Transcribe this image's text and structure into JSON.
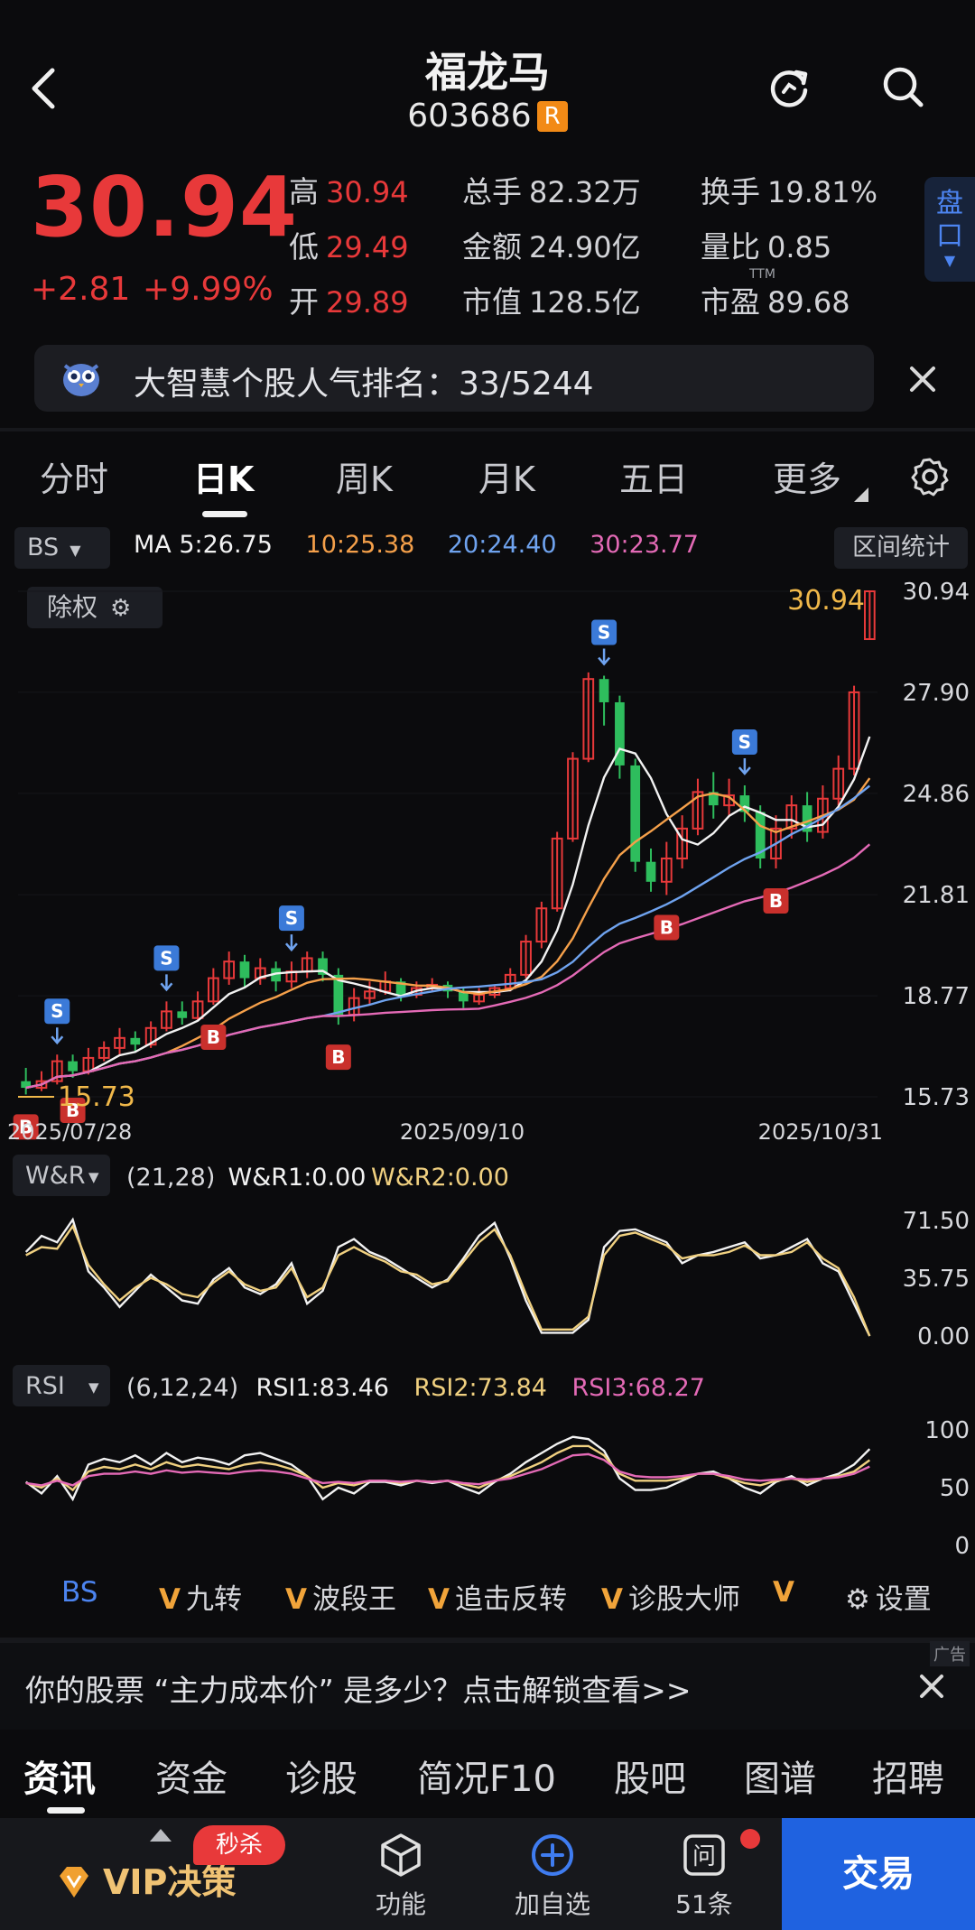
{
  "header": {
    "stock_name": "福龙马",
    "stock_code": "603686",
    "code_badge": "R",
    "back_icon": "chevron-left-icon",
    "refresh_icon": "refresh-icon",
    "search_icon": "search-icon"
  },
  "quote": {
    "price": "30.94",
    "change": "+2.81",
    "change_pct": "+9.99%",
    "fields": [
      {
        "label": "高",
        "value": "30.94",
        "color": "#e8393a"
      },
      {
        "label": "低",
        "value": "29.49",
        "color": "#e8393a"
      },
      {
        "label": "开",
        "value": "29.89",
        "color": "#e8393a"
      },
      {
        "label": "总手",
        "value": "82.32万",
        "color": "#ececec"
      },
      {
        "label": "金额",
        "value": "24.90亿",
        "color": "#ececec"
      },
      {
        "label": "市值",
        "value": "128.5亿",
        "color": "#ececec"
      },
      {
        "label": "换手",
        "value": "19.81%",
        "color": "#ececec"
      },
      {
        "label": "量比",
        "value": "0.85",
        "color": "#ececec"
      },
      {
        "label": "市盈",
        "value": "89.68",
        "color": "#ececec"
      }
    ],
    "pe_tag": "TTM",
    "pankou_label": "盘口"
  },
  "banner": {
    "text": "大智慧个股人气排名：33/5244",
    "icon": "owl-icon"
  },
  "period_tabs": [
    "分时",
    "日K",
    "周K",
    "月K",
    "五日",
    "更多"
  ],
  "active_period": "日K",
  "chart_toolbar": {
    "bs_select": "BS",
    "ma_items": [
      {
        "text": "MA 5:26.75",
        "color": "#f2f2f2"
      },
      {
        "text": "10:25.38",
        "color": "#f5a04a"
      },
      {
        "text": "20:24.40",
        "color": "#6fa3ef"
      },
      {
        "text": "30:23.77",
        "color": "#e46ab6"
      }
    ],
    "interval_stats": "区间统计",
    "ex_rights": "除权"
  },
  "chart_data": [
    {
      "type": "candlestick",
      "title": "",
      "price_axis_labels": [
        "30.94",
        "27.90",
        "24.86",
        "21.81",
        "18.77",
        "15.73"
      ],
      "date_labels": [
        "2025/07/28",
        "2025/09/10",
        "2025/10/31"
      ],
      "last_price_label": "30.94",
      "low_price_label": "15.73",
      "ylim": [
        15.73,
        30.94
      ],
      "candles": [
        [
          16.2,
          16.0,
          16.6,
          15.8
        ],
        [
          16.0,
          16.2,
          16.5,
          15.9
        ],
        [
          16.2,
          16.8,
          17.0,
          16.1
        ],
        [
          16.8,
          16.5,
          17.0,
          16.3
        ],
        [
          16.5,
          16.9,
          17.2,
          16.4
        ],
        [
          16.9,
          17.2,
          17.4,
          16.8
        ],
        [
          17.2,
          17.5,
          17.8,
          17.0
        ],
        [
          17.5,
          17.3,
          17.7,
          17.1
        ],
        [
          17.3,
          17.8,
          18.0,
          17.2
        ],
        [
          17.8,
          18.3,
          18.6,
          17.7
        ],
        [
          18.3,
          18.1,
          18.6,
          17.9
        ],
        [
          18.1,
          18.6,
          18.9,
          18.0
        ],
        [
          18.6,
          19.3,
          19.6,
          18.5
        ],
        [
          19.3,
          19.8,
          20.1,
          19.1
        ],
        [
          19.8,
          19.3,
          20.0,
          19.0
        ],
        [
          19.3,
          19.6,
          19.9,
          19.1
        ],
        [
          19.6,
          19.2,
          19.8,
          18.9
        ],
        [
          19.2,
          19.5,
          19.8,
          19.0
        ],
        [
          19.5,
          19.9,
          20.1,
          19.3
        ],
        [
          19.9,
          19.4,
          20.1,
          19.2
        ],
        [
          19.4,
          18.2,
          19.6,
          17.9
        ],
        [
          18.2,
          18.7,
          19.0,
          18.0
        ],
        [
          18.7,
          18.9,
          19.2,
          18.5
        ],
        [
          18.9,
          19.2,
          19.5,
          18.8
        ],
        [
          19.2,
          18.8,
          19.3,
          18.6
        ],
        [
          18.8,
          19.0,
          19.2,
          18.7
        ],
        [
          19.0,
          19.1,
          19.3,
          18.9
        ],
        [
          19.1,
          18.9,
          19.2,
          18.7
        ],
        [
          18.9,
          18.6,
          19.0,
          18.4
        ],
        [
          18.6,
          18.8,
          19.0,
          18.5
        ],
        [
          18.8,
          19.0,
          19.1,
          18.7
        ],
        [
          19.0,
          19.4,
          19.6,
          18.9
        ],
        [
          19.4,
          20.4,
          20.6,
          19.3
        ],
        [
          20.4,
          21.4,
          21.6,
          20.2
        ],
        [
          21.4,
          23.5,
          23.7,
          21.3
        ],
        [
          23.5,
          25.9,
          26.1,
          23.4
        ],
        [
          25.9,
          28.3,
          28.5,
          25.8
        ],
        [
          28.3,
          27.6,
          28.4,
          26.9
        ],
        [
          27.6,
          25.7,
          27.8,
          25.3
        ],
        [
          25.7,
          22.8,
          25.9,
          22.5
        ],
        [
          22.8,
          22.2,
          23.2,
          21.9
        ],
        [
          22.2,
          22.9,
          23.4,
          21.8
        ],
        [
          22.9,
          23.8,
          24.2,
          22.6
        ],
        [
          23.8,
          24.9,
          25.3,
          23.6
        ],
        [
          24.9,
          24.5,
          25.5,
          24.1
        ],
        [
          24.5,
          24.8,
          25.3,
          24.2
        ],
        [
          24.8,
          24.3,
          25.1,
          24.0
        ],
        [
          24.3,
          22.9,
          24.5,
          22.6
        ],
        [
          22.9,
          23.8,
          24.2,
          22.6
        ],
        [
          23.8,
          24.5,
          24.8,
          23.5
        ],
        [
          24.5,
          23.7,
          24.9,
          23.4
        ],
        [
          23.7,
          24.7,
          25.1,
          23.5
        ],
        [
          24.7,
          25.6,
          26.0,
          24.5
        ],
        [
          25.6,
          27.9,
          28.1,
          25.4
        ],
        [
          29.5,
          30.94,
          30.94,
          29.49
        ]
      ],
      "ma_series": [
        {
          "name": "MA5",
          "color": "#f2f2f2"
        },
        {
          "name": "MA10",
          "color": "#f5a04a"
        },
        {
          "name": "MA20",
          "color": "#6fa3ef"
        },
        {
          "name": "MA30",
          "color": "#e46ab6"
        }
      ],
      "signals": [
        {
          "type": "B",
          "index": 0
        },
        {
          "type": "S",
          "index": 2
        },
        {
          "type": "B",
          "index": 3
        },
        {
          "type": "S",
          "index": 9
        },
        {
          "type": "B",
          "index": 12
        },
        {
          "type": "S",
          "index": 17
        },
        {
          "type": "B",
          "index": 20
        },
        {
          "type": "S",
          "index": 37
        },
        {
          "type": "B",
          "index": 41
        },
        {
          "type": "S",
          "index": 46
        },
        {
          "type": "B",
          "index": 48
        }
      ]
    },
    {
      "type": "line",
      "title": "W&R",
      "params": "(21,28)",
      "legend": [
        {
          "name": "W&R1:0.00",
          "color": "#f2f2f2"
        },
        {
          "name": "W&R2:0.00",
          "color": "#f0d080"
        }
      ],
      "axis_labels": [
        "71.50",
        "35.75",
        "0.00"
      ],
      "ylim": [
        0,
        71.5
      ],
      "series": [
        {
          "name": "W&R1",
          "color": "#f2f2f2",
          "values": [
            52,
            62,
            58,
            72,
            40,
            30,
            18,
            28,
            38,
            30,
            22,
            20,
            35,
            42,
            30,
            26,
            32,
            45,
            20,
            28,
            55,
            60,
            52,
            48,
            42,
            36,
            30,
            35,
            48,
            62,
            70,
            48,
            22,
            2,
            2,
            2,
            10,
            55,
            65,
            66,
            62,
            58,
            45,
            50,
            52,
            55,
            58,
            48,
            50,
            55,
            60,
            45,
            40,
            20,
            0
          ]
        },
        {
          "name": "W&R2",
          "color": "#f0d080",
          "values": [
            50,
            55,
            54,
            68,
            44,
            32,
            22,
            30,
            36,
            32,
            26,
            24,
            33,
            40,
            32,
            28,
            30,
            42,
            24,
            30,
            50,
            55,
            50,
            46,
            40,
            38,
            32,
            34,
            46,
            58,
            66,
            50,
            26,
            4,
            4,
            4,
            12,
            50,
            62,
            64,
            60,
            56,
            48,
            50,
            50,
            52,
            56,
            50,
            50,
            52,
            58,
            48,
            42,
            24,
            0
          ]
        }
      ]
    },
    {
      "type": "line",
      "title": "RSI",
      "params": "(6,12,24)",
      "legend": [
        {
          "name": "RSI1:83.46",
          "color": "#f2f2f2"
        },
        {
          "name": "RSI2:73.84",
          "color": "#f0d080"
        },
        {
          "name": "RSI3:68.27",
          "color": "#e46ab6"
        }
      ],
      "axis_labels": [
        "100",
        "50",
        "0"
      ],
      "ylim": [
        0,
        100
      ],
      "series": [
        {
          "name": "RSI1",
          "color": "#f2f2f2",
          "values": [
            55,
            45,
            60,
            40,
            70,
            75,
            72,
            78,
            70,
            80,
            72,
            76,
            74,
            70,
            78,
            80,
            75,
            70,
            60,
            40,
            50,
            45,
            55,
            55,
            52,
            56,
            54,
            56,
            50,
            45,
            55,
            62,
            72,
            80,
            88,
            94,
            92,
            82,
            58,
            48,
            48,
            50,
            56,
            62,
            64,
            58,
            50,
            45,
            55,
            60,
            52,
            58,
            62,
            70,
            83.46
          ]
        },
        {
          "name": "RSI2",
          "color": "#f0d080",
          "values": [
            54,
            50,
            58,
            48,
            64,
            68,
            66,
            70,
            66,
            72,
            68,
            70,
            68,
            66,
            70,
            72,
            70,
            66,
            60,
            50,
            54,
            52,
            56,
            56,
            54,
            56,
            55,
            56,
            53,
            50,
            56,
            60,
            66,
            72,
            80,
            86,
            86,
            78,
            62,
            56,
            56,
            56,
            58,
            62,
            62,
            58,
            54,
            52,
            56,
            58,
            55,
            58,
            60,
            64,
            73.84
          ]
        },
        {
          "name": "RSI3",
          "color": "#e46ab6",
          "values": [
            54,
            52,
            56,
            52,
            60,
            62,
            62,
            64,
            62,
            65,
            63,
            64,
            63,
            62,
            64,
            65,
            64,
            62,
            58,
            54,
            55,
            54,
            56,
            56,
            55,
            56,
            55,
            56,
            54,
            53,
            56,
            58,
            62,
            66,
            72,
            78,
            79,
            74,
            64,
            60,
            59,
            59,
            60,
            62,
            62,
            60,
            57,
            56,
            57,
            58,
            57,
            58,
            59,
            62,
            68.27
          ]
        }
      ]
    }
  ],
  "indicator_selects": {
    "wr": "W&R",
    "rsi": "RSI"
  },
  "function_strip": {
    "bs": "BS",
    "items": [
      "九转",
      "波段王",
      "追击反转",
      "诊股大师"
    ],
    "trailing_v": "V",
    "settings": "设置"
  },
  "ad": {
    "tag": "广告",
    "text": "你的股票 “主力成本价” 是多少？点击解锁查看>>"
  },
  "content_tabs": [
    "资讯",
    "资金",
    "诊股",
    "简况F10",
    "股吧",
    "图谱",
    "招聘"
  ],
  "bottom_bar": {
    "vip": "VIP决策",
    "flash_badge": "秒杀",
    "items": [
      {
        "label": "功能",
        "icon": "cube-icon"
      },
      {
        "label": "加自选",
        "icon": "plus-circle-icon"
      },
      {
        "label": "51条",
        "icon": "ask-icon",
        "icon_text": "问"
      }
    ],
    "trade": "交易"
  },
  "colors": {
    "up": "#e8393a",
    "down": "#2ebd5d",
    "accent": "#1f62e0",
    "bg": "#0b0b0d"
  }
}
